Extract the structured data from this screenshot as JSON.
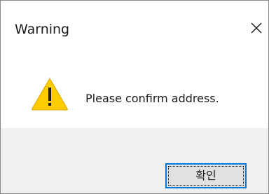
{
  "window": {
    "title": "Warning",
    "close_icon": "close-icon"
  },
  "content": {
    "icon": "warning-icon",
    "message": "Please confirm address."
  },
  "footer": {
    "ok_label": "확인"
  },
  "colors": {
    "warning_fill": "#ffcc00",
    "footer_bg": "#f0f0f0",
    "button_border": "#0078d7",
    "button_bg": "#e1e1e1"
  }
}
